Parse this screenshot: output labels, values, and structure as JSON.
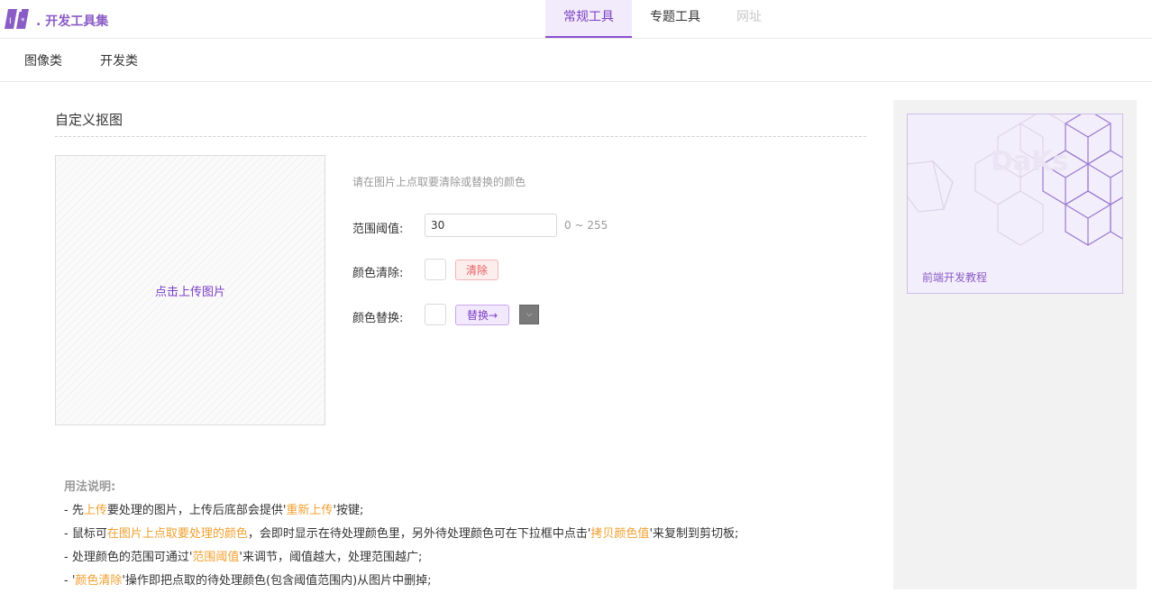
{
  "header": {
    "logo_text": ". 开发工具集",
    "logo_mark": "logo-icon",
    "nav": [
      {
        "label": "常规工具",
        "state": "active"
      },
      {
        "label": "专题工具",
        "state": "normal"
      },
      {
        "label": "网址",
        "state": "disabled"
      }
    ]
  },
  "subnav": {
    "items": [
      "图像类",
      "开发类"
    ]
  },
  "main": {
    "title": "自定义抠图",
    "upload_text": "点击上传图片",
    "hint": "请在图片上点取要清除或替换的颜色",
    "range": {
      "label": "范围阈值:",
      "value": "30",
      "hint": "0 ~ 255"
    },
    "clear": {
      "label": "颜色清除:",
      "button": "清除"
    },
    "replace": {
      "label": "颜色替换:",
      "button": "替换→",
      "picker_icon": "chevron-down-icon"
    }
  },
  "usage": {
    "title": "用法说明:",
    "lines": [
      [
        {
          "t": "- 先"
        },
        {
          "t": "上传",
          "hl": true
        },
        {
          "t": "要处理的图片，上传后底部会提供'"
        },
        {
          "t": "重新上传",
          "hl": true
        },
        {
          "t": "'按键;"
        }
      ],
      [
        {
          "t": "- 鼠标可"
        },
        {
          "t": "在图片上点取要处理的颜色",
          "hl": true
        },
        {
          "t": "，会即时显示在待处理颜色里，另外待处理颜色可在下拉框中点击'"
        },
        {
          "t": "拷贝颜色值",
          "hl": true
        },
        {
          "t": "'来复制到剪切板;"
        }
      ],
      [
        {
          "t": "- 处理颜色的范围可通过'"
        },
        {
          "t": "范围阈值",
          "hl": true
        },
        {
          "t": "'来调节，阈值越大，处理范围越广;"
        }
      ],
      [
        {
          "t": "- '"
        },
        {
          "t": "颜色清除",
          "hl": true
        },
        {
          "t": "'操作即把点取的待处理颜色(包含阈值范围内)从图片中删掉;"
        }
      ]
    ]
  },
  "sidebar": {
    "ad_text": "前端开发教程"
  },
  "colors": {
    "accent": "#7b3fc4",
    "highlight": "#f0a030",
    "clear_button": "#e36060",
    "picker": "#7a7a7a"
  }
}
